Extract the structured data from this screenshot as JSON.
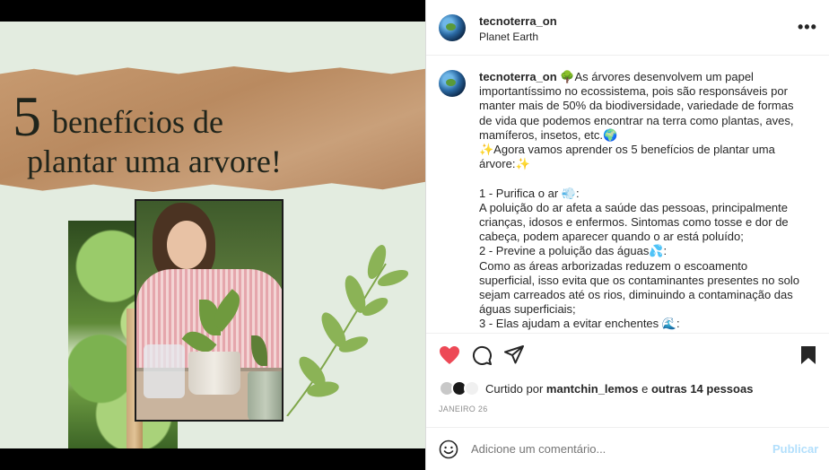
{
  "media": {
    "title_number": "5",
    "title_line1": "benefícios de",
    "title_line2": "plantar uma arvore!"
  },
  "header": {
    "username": "tecnoterra_on",
    "location": "Planet Earth",
    "more_icon": "more-horizontal-icon"
  },
  "caption": {
    "username": "tecnoterra_on",
    "p1": "🌳As árvores desenvolvem um papel importantíssimo no ecossistema, pois são responsáveis por manter mais de 50% da biodiversidade, variedade de formas de vida que podemos encontrar na terra como plantas, aves, mamíferos, insetos, etc.🌍",
    "p2": "✨Agora vamos aprender os 5 benefícios de plantar uma árvore:✨",
    "p3": "1 - Purifica o ar 💨:",
    "p4": "A poluição do ar afeta a saúde das pessoas, principalmente crianças, idosos e enfermos. Sintomas como tosse e dor de cabeça, podem aparecer quando o ar está poluído;",
    "p5": "2 - Previne a poluição das águas💦:",
    "p6": "Como as áreas arborizadas reduzem o escoamento superficial, isso evita que os contaminantes presentes no solo sejam carreados até os rios, diminuindo a contaminação das águas superficiais;",
    "p7": "3 - Elas ajudam a evitar enchentes 🌊:"
  },
  "actions": {
    "like_icon": "heart-filled-icon",
    "comment_icon": "comment-icon",
    "share_icon": "send-icon",
    "save_icon": "bookmark-icon",
    "like_color": "#ed4956"
  },
  "likes": {
    "prefix": "Curtido por ",
    "user": "mantchin_lemos",
    "middle": " e ",
    "others": "outras 14 pessoas"
  },
  "date": "JANEIRO 26",
  "comment": {
    "placeholder": "Adicione um comentário...",
    "publish_label": "Publicar",
    "emoji_icon": "smiley-icon"
  }
}
